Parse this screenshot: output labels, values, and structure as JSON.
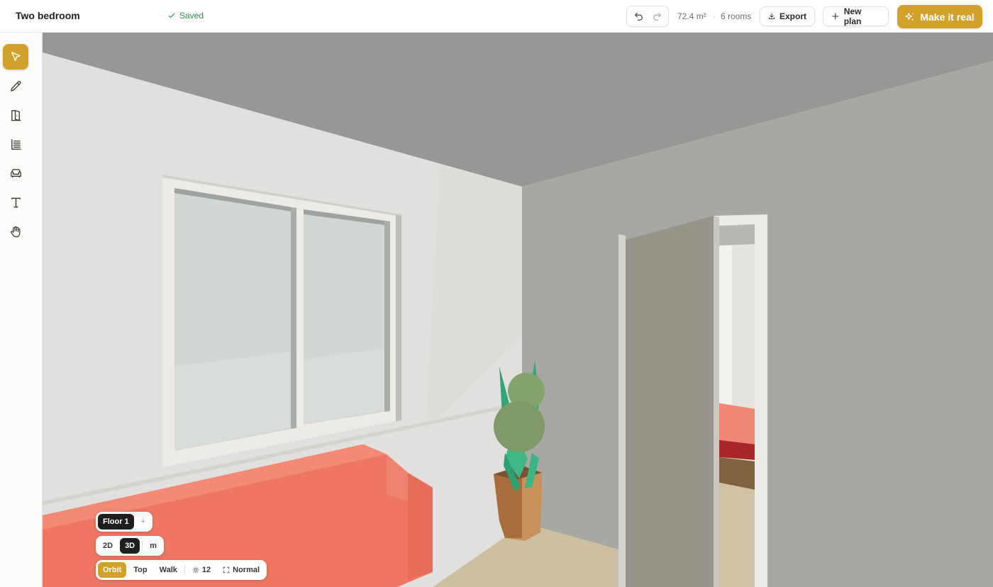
{
  "header": {
    "title": "Two bedroom",
    "status": "Saved",
    "area": "72.4 m²",
    "separator": "·",
    "rooms": "6 rooms",
    "export_label": "Export",
    "new_plan_label": "New plan",
    "make_real_label": "Make it real"
  },
  "toolbar": {
    "tools": [
      "select",
      "draw",
      "door",
      "stairs",
      "furniture",
      "text",
      "pan"
    ],
    "active_tool": "select"
  },
  "overlay": {
    "floor_label": "Floor 1",
    "add_floor": "+",
    "view_2d": "2D",
    "view_3d": "3D",
    "unit": "m",
    "cam_orbit": "Orbit",
    "cam_top": "Top",
    "cam_walk": "Walk",
    "sun_value": "12",
    "quality": "Normal"
  },
  "colors": {
    "accent": "#d2a12b",
    "saved": "#2f8a4e",
    "sofa": "#ee7663",
    "ceiling": "#979795",
    "floor": "#cdbf9f"
  }
}
